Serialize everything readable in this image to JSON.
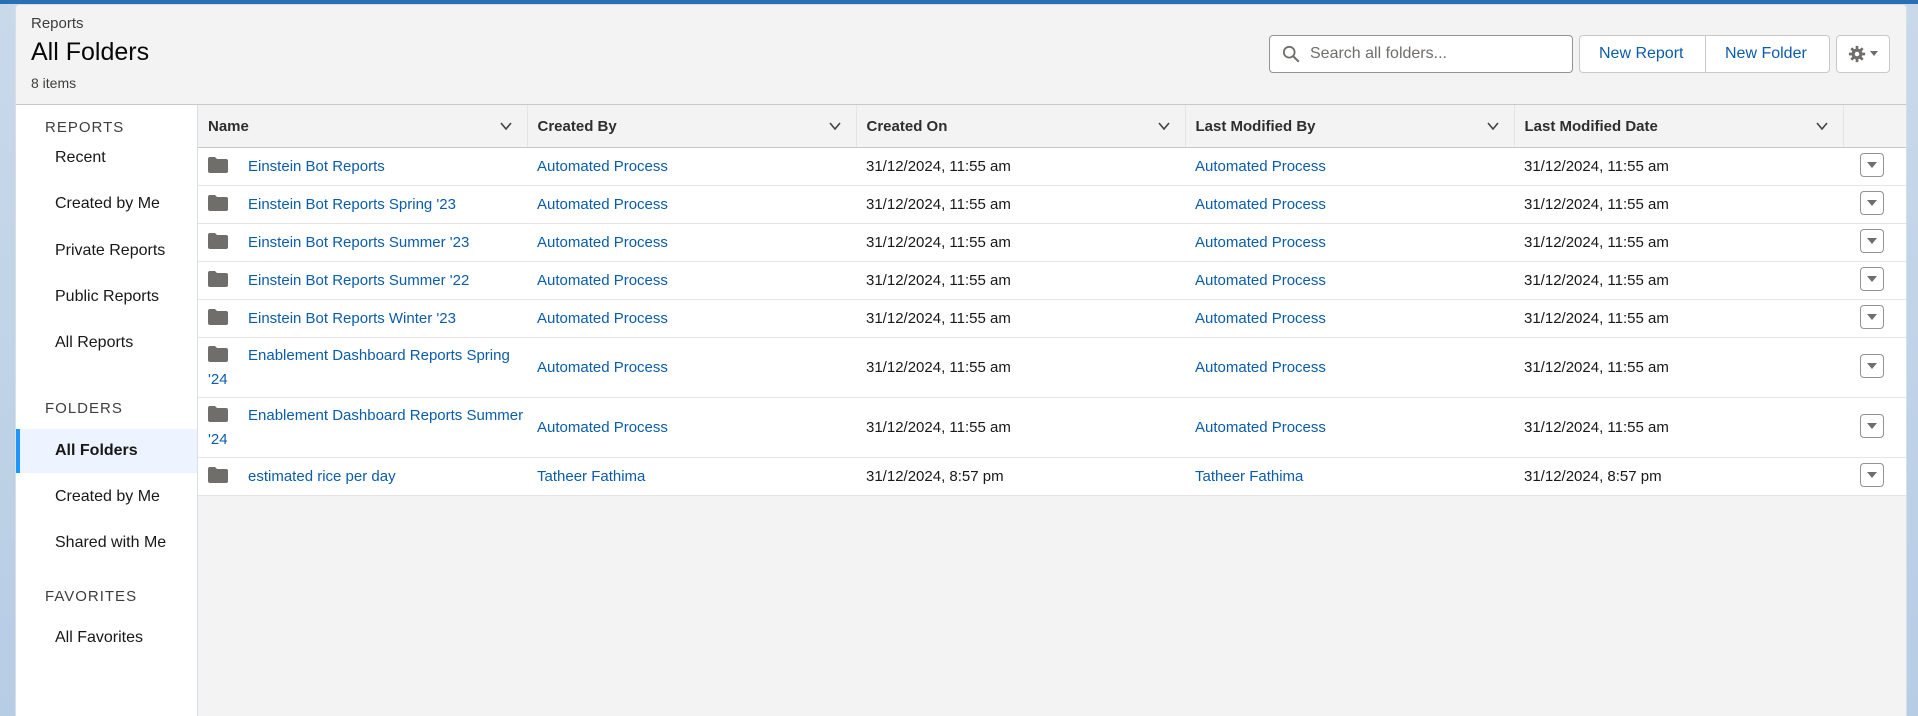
{
  "header": {
    "eyebrow": "Reports",
    "title": "All Folders",
    "item_count": "8 items"
  },
  "search": {
    "placeholder": "Search all folders...",
    "icon": "search-icon"
  },
  "actions": {
    "new_report": "New Report",
    "new_folder": "New Folder",
    "settings_icon": "gear-icon"
  },
  "sidebar": {
    "reports_title": "REPORTS",
    "reports_items": [
      "Recent",
      "Created by Me",
      "Private Reports",
      "Public Reports",
      "All Reports"
    ],
    "folders_title": "FOLDERS",
    "folders_items": [
      "All Folders",
      "Created by Me",
      "Shared with Me"
    ],
    "active_item": "All Folders",
    "favorites_title": "FAVORITES",
    "favorites_items": [
      "All Favorites"
    ]
  },
  "table": {
    "columns": [
      "Name",
      "Created By",
      "Created On",
      "Last Modified By",
      "Last Modified Date"
    ],
    "rows": [
      {
        "name": "Einstein Bot Reports",
        "created_by": "Automated Process",
        "created_on": "31/12/2024, 11:55 am",
        "modified_by": "Automated Process",
        "modified_date": "31/12/2024, 11:55 am"
      },
      {
        "name": "Einstein Bot Reports Spring '23",
        "created_by": "Automated Process",
        "created_on": "31/12/2024, 11:55 am",
        "modified_by": "Automated Process",
        "modified_date": "31/12/2024, 11:55 am"
      },
      {
        "name": "Einstein Bot Reports Summer '23",
        "created_by": "Automated Process",
        "created_on": "31/12/2024, 11:55 am",
        "modified_by": "Automated Process",
        "modified_date": "31/12/2024, 11:55 am"
      },
      {
        "name": "Einstein Bot Reports Summer '22",
        "created_by": "Automated Process",
        "created_on": "31/12/2024, 11:55 am",
        "modified_by": "Automated Process",
        "modified_date": "31/12/2024, 11:55 am"
      },
      {
        "name": "Einstein Bot Reports Winter '23",
        "created_by": "Automated Process",
        "created_on": "31/12/2024, 11:55 am",
        "modified_by": "Automated Process",
        "modified_date": "31/12/2024, 11:55 am"
      },
      {
        "name": "Enablement Dashboard Reports Spring '24",
        "created_by": "Automated Process",
        "created_on": "31/12/2024, 11:55 am",
        "modified_by": "Automated Process",
        "modified_date": "31/12/2024, 11:55 am"
      },
      {
        "name": "Enablement Dashboard Reports Summer '24",
        "created_by": "Automated Process",
        "created_on": "31/12/2024, 11:55 am",
        "modified_by": "Automated Process",
        "modified_date": "31/12/2024, 11:55 am"
      },
      {
        "name": "estimated rice per day",
        "created_by": "Tatheer Fathima",
        "created_on": "31/12/2024, 8:57 pm",
        "modified_by": "Tatheer Fathima",
        "modified_date": "31/12/2024, 8:57 pm"
      }
    ]
  },
  "colors": {
    "link": "#0b5cab",
    "active_accent": "#1b96ff",
    "header_bg": "#f3f3f3"
  }
}
